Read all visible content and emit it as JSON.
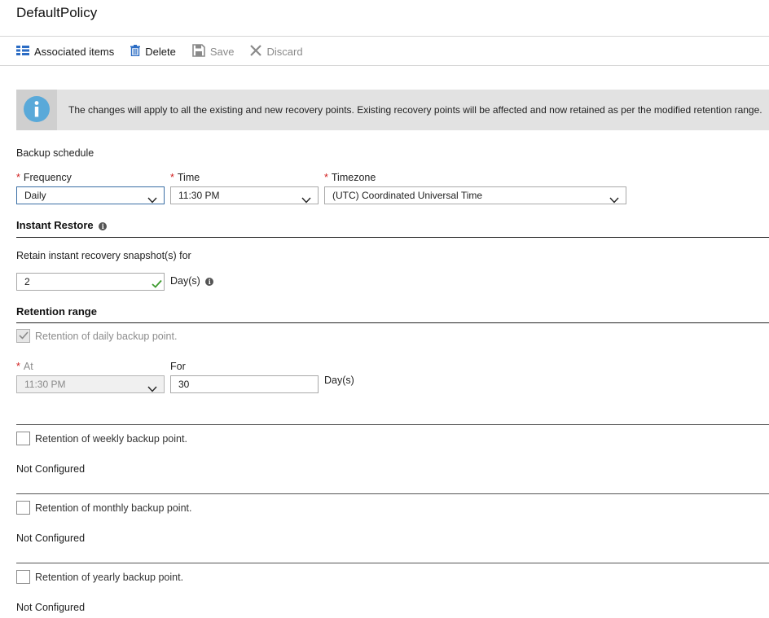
{
  "page": {
    "title": "DefaultPolicy"
  },
  "toolbar": {
    "associated_label": "Associated items",
    "delete_label": "Delete",
    "save_label": "Save",
    "discard_label": "Discard"
  },
  "banner": {
    "message": "The changes will apply to all the existing and new recovery points. Existing recovery points will be affected and now retained as per the modified retention range."
  },
  "schedule": {
    "section_label": "Backup schedule",
    "frequency_label": "Frequency",
    "frequency_value": "Daily",
    "time_label": "Time",
    "time_value": "11:30 PM",
    "timezone_label": "Timezone",
    "timezone_value": "(UTC) Coordinated Universal Time"
  },
  "instant_restore": {
    "heading": "Instant Restore",
    "retain_label": "Retain instant recovery snapshot(s) for",
    "retain_value": "2",
    "unit": "Day(s)"
  },
  "retention": {
    "heading": "Retention range",
    "daily": {
      "label": "Retention of daily backup point.",
      "at_label": "At",
      "at_value": "11:30 PM",
      "for_label": "For",
      "for_value": "30",
      "unit": "Day(s)"
    },
    "weekly": {
      "label": "Retention of weekly backup point.",
      "status": "Not Configured"
    },
    "monthly": {
      "label": "Retention of monthly backup point.",
      "status": "Not Configured"
    },
    "yearly": {
      "label": "Retention of yearly backup point.",
      "status": "Not Configured"
    }
  },
  "icons": {
    "associated": "list-grid-icon",
    "delete": "trash-icon",
    "save": "floppy-disk-icon",
    "discard": "x-icon",
    "banner": "info-icon",
    "valid": "checkmark-icon",
    "dropdown": "chevron-down-icon"
  },
  "colors": {
    "accent_blue": "#2b6cc4",
    "info_blue": "#59a9d9",
    "required_red": "#d01c1c",
    "valid_green": "#3c9a2d",
    "banner_bg": "#e2e2e2"
  }
}
